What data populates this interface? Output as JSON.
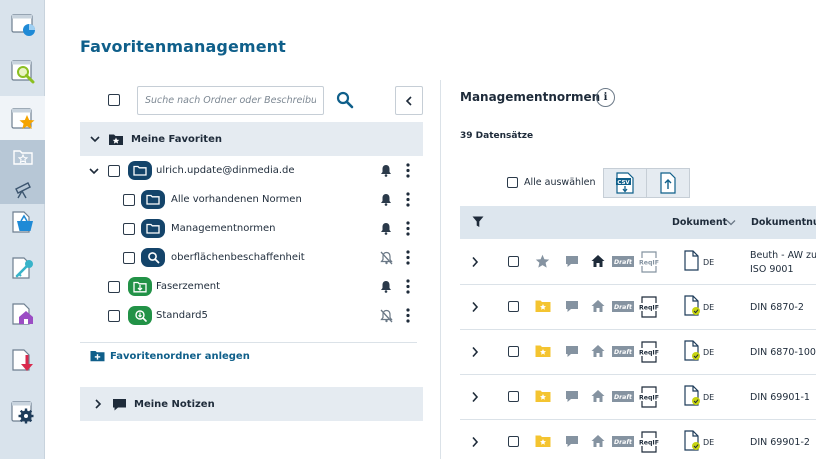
{
  "page_title": "Favoritenmanagement",
  "left_panel": {
    "search_placeholder": "Suche nach Ordner oder Beschreibung",
    "favorites_section_label": "Meine Favoriten",
    "items": [
      {
        "name": "ulrich.update@dinmedia.de",
        "icon": "folder-icon",
        "color": "blue",
        "notification": "bell-icon"
      },
      {
        "name": "Alle vorhandenen Normen",
        "icon": "folder-icon",
        "color": "blue",
        "notification": "bell-icon"
      },
      {
        "name": "Managementnormen",
        "icon": "folder-icon",
        "color": "blue",
        "notification": "bell-icon"
      },
      {
        "name": "oberflächenbeschaffenheit",
        "icon": "search-icon",
        "color": "blue",
        "notification": "bell-off-icon"
      },
      {
        "name": "Faserzement",
        "icon": "folder-download-icon",
        "color": "green",
        "notification": "bell-icon"
      },
      {
        "name": "Standard5",
        "icon": "search-download-icon",
        "color": "green",
        "notification": "bell-off-icon"
      }
    ],
    "new_folder_label": "Favoritenordner anlegen",
    "notes_section_label": "Meine Notizen"
  },
  "right_panel": {
    "title": "Managementnormen",
    "info_label": "i",
    "record_count": "39 Datensätze",
    "select_all_label": "Alle auswählen",
    "csv_label": "CSV",
    "columns": {
      "document": "Dokument",
      "document_number": "Dokumentnum"
    },
    "draft_badge": "Draft",
    "reqif_badge": "ReqIF",
    "rows": [
      {
        "doc_lines": [
          "Beuth - AW zu",
          "ISO 9001"
        ],
        "lang": "DE",
        "favorite": "star-icon",
        "doc_status": "plain"
      },
      {
        "doc_lines": [
          "DIN 6870-2"
        ],
        "lang": "DE",
        "favorite": "yellow-folder-icon",
        "doc_status": "checked"
      },
      {
        "doc_lines": [
          "DIN 6870-100"
        ],
        "lang": "DE",
        "favorite": "yellow-folder-icon",
        "doc_status": "checked"
      },
      {
        "doc_lines": [
          "DIN 69901-1"
        ],
        "lang": "DE",
        "favorite": "yellow-folder-icon",
        "doc_status": "checked"
      },
      {
        "doc_lines": [
          "DIN 69901-2"
        ],
        "lang": "DE",
        "favorite": "yellow-folder-icon",
        "doc_status": "checked"
      }
    ]
  },
  "colors": {
    "brand": "#0f5f8a",
    "folder_blue": "#14446a",
    "folder_green": "#229247",
    "yellow": "#f4c430",
    "rail": "#d9e3ec"
  }
}
